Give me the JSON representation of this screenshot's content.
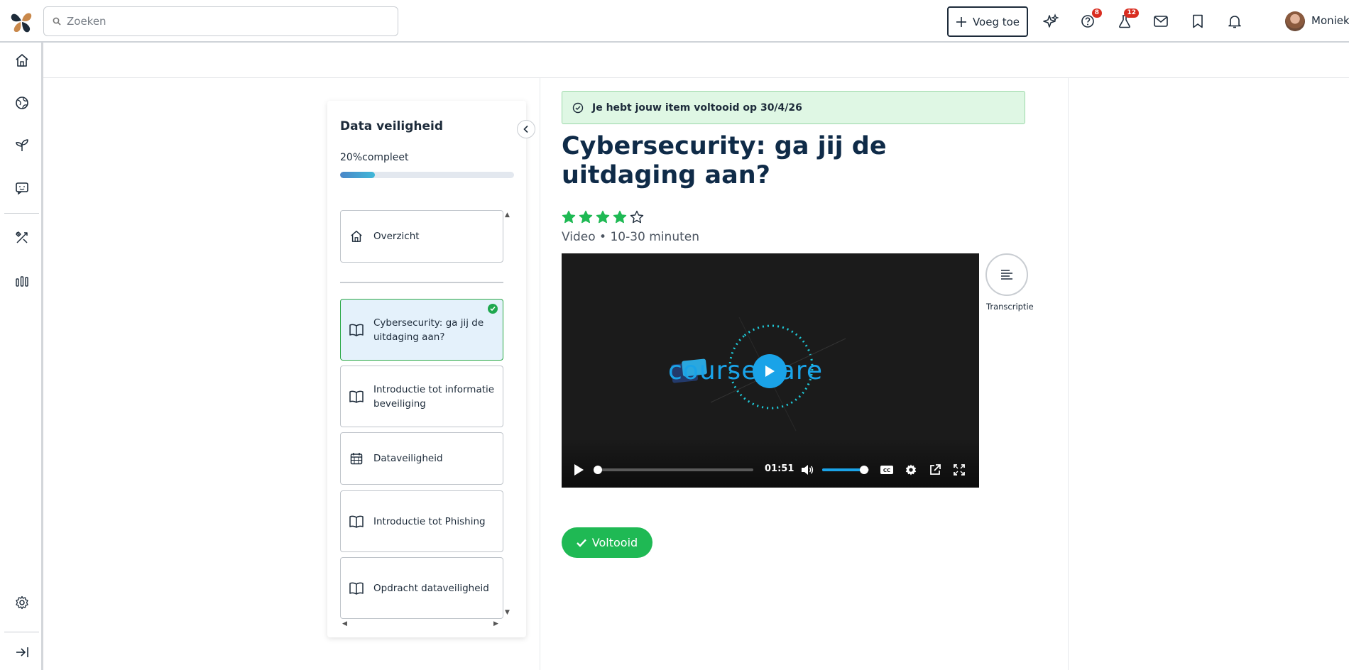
{
  "header": {
    "search_placeholder": "Zoeken",
    "add_label": "Voeg toe",
    "help_badge": "8",
    "lab_badge": "12",
    "user_name": "Moniek"
  },
  "course": {
    "title": "Data veiligheid",
    "progress_label": "20%compleet",
    "progress_fraction": 0.2,
    "overview": "Overzicht",
    "items": [
      {
        "label": "Cybersecurity: ga jij de uitdaging aan?",
        "icon": "book-icon",
        "active": true,
        "completed": true
      },
      {
        "label": "Introductie tot informatie beveiliging",
        "icon": "book-icon"
      },
      {
        "label": "Dataveiligheid",
        "icon": "calendar-icon"
      },
      {
        "label": "Introductie tot Phishing",
        "icon": "book-icon"
      },
      {
        "label": "Opdracht dataveiligheid",
        "icon": "book-icon"
      }
    ]
  },
  "content": {
    "banner": "Je hebt jouw item voltooid op 30/4/26",
    "title": "Cybersecurity: ga jij de uitdaging aan?",
    "rating": 4,
    "rating_max": 5,
    "meta": "Video • 10-30 minuten",
    "video_time": "01:51",
    "video_progress": 0.0,
    "volume": 0.9,
    "video_brand": "courseware",
    "transcript_label": "Transcriptie",
    "done_label": "Voltooid"
  },
  "colors": {
    "primary": "#0f2b48",
    "success": "#1fb954",
    "accent": "#1aa3e8"
  }
}
